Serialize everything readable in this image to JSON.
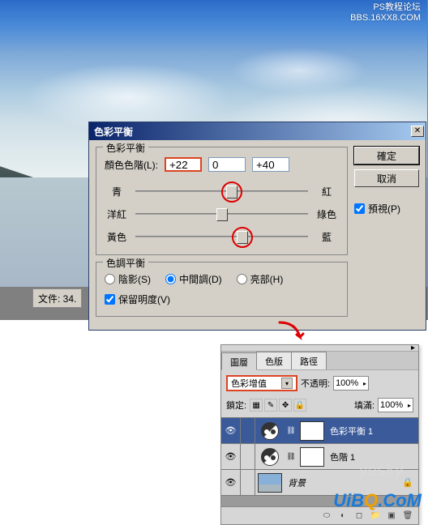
{
  "watermark_top": {
    "line1": "PS教程论坛",
    "line2": "BBS.16XX8.COM"
  },
  "status_bar": "文件: 34.",
  "dialog": {
    "title": "色彩平衡",
    "group1_title": "色彩平衡",
    "level_label": "顏色色階(L):",
    "levels": [
      "+22",
      "0",
      "+40"
    ],
    "sliders": [
      {
        "left": "青",
        "right": "紅",
        "pos": 56,
        "circled": true
      },
      {
        "left": "洋紅",
        "right": "綠色",
        "pos": 50,
        "circled": false
      },
      {
        "left": "黃色",
        "right": "藍",
        "pos": 62,
        "circled": true
      }
    ],
    "group2_title": "色調平衡",
    "radios": {
      "shadows": "陰影(S)",
      "midtones": "中間調(D)",
      "highlights": "亮部(H)"
    },
    "preserve_lum": "保留明度(V)",
    "ok": "確定",
    "cancel": "取消",
    "preview": "預視(P)"
  },
  "layers": {
    "tabs": [
      "圖層",
      "色版",
      "路徑"
    ],
    "blend_mode": "色彩增值",
    "opacity_label": "不透明:",
    "opacity_value": "100%",
    "lock_label": "鎖定:",
    "fill_label": "填滿:",
    "fill_value": "100%",
    "items": [
      {
        "name": "色彩平衡 1"
      },
      {
        "name": "色階 1"
      },
      {
        "name": "背景"
      }
    ]
  },
  "wm1": "yesky",
  "wm2_pre": "UiB",
  "wm2_mid": "Q",
  "wm2_post": ".CoM"
}
